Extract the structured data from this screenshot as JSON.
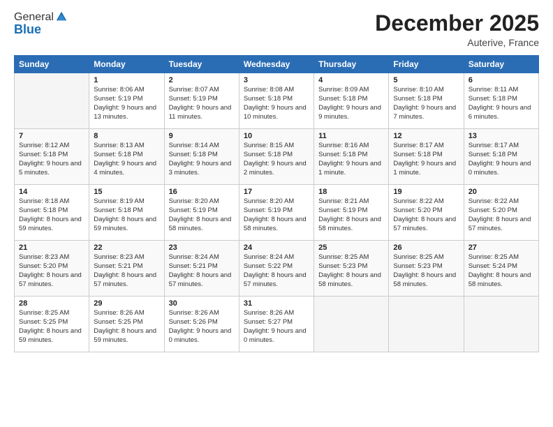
{
  "logo": {
    "general": "General",
    "blue": "Blue"
  },
  "title": "December 2025",
  "location": "Auterive, France",
  "header_days": [
    "Sunday",
    "Monday",
    "Tuesday",
    "Wednesday",
    "Thursday",
    "Friday",
    "Saturday"
  ],
  "weeks": [
    [
      {
        "day": "",
        "sunrise": "",
        "sunset": "",
        "daylight": ""
      },
      {
        "day": "1",
        "sunrise": "Sunrise: 8:06 AM",
        "sunset": "Sunset: 5:19 PM",
        "daylight": "Daylight: 9 hours and 13 minutes."
      },
      {
        "day": "2",
        "sunrise": "Sunrise: 8:07 AM",
        "sunset": "Sunset: 5:19 PM",
        "daylight": "Daylight: 9 hours and 11 minutes."
      },
      {
        "day": "3",
        "sunrise": "Sunrise: 8:08 AM",
        "sunset": "Sunset: 5:18 PM",
        "daylight": "Daylight: 9 hours and 10 minutes."
      },
      {
        "day": "4",
        "sunrise": "Sunrise: 8:09 AM",
        "sunset": "Sunset: 5:18 PM",
        "daylight": "Daylight: 9 hours and 9 minutes."
      },
      {
        "day": "5",
        "sunrise": "Sunrise: 8:10 AM",
        "sunset": "Sunset: 5:18 PM",
        "daylight": "Daylight: 9 hours and 7 minutes."
      },
      {
        "day": "6",
        "sunrise": "Sunrise: 8:11 AM",
        "sunset": "Sunset: 5:18 PM",
        "daylight": "Daylight: 9 hours and 6 minutes."
      }
    ],
    [
      {
        "day": "7",
        "sunrise": "Sunrise: 8:12 AM",
        "sunset": "Sunset: 5:18 PM",
        "daylight": "Daylight: 9 hours and 5 minutes."
      },
      {
        "day": "8",
        "sunrise": "Sunrise: 8:13 AM",
        "sunset": "Sunset: 5:18 PM",
        "daylight": "Daylight: 9 hours and 4 minutes."
      },
      {
        "day": "9",
        "sunrise": "Sunrise: 8:14 AM",
        "sunset": "Sunset: 5:18 PM",
        "daylight": "Daylight: 9 hours and 3 minutes."
      },
      {
        "day": "10",
        "sunrise": "Sunrise: 8:15 AM",
        "sunset": "Sunset: 5:18 PM",
        "daylight": "Daylight: 9 hours and 2 minutes."
      },
      {
        "day": "11",
        "sunrise": "Sunrise: 8:16 AM",
        "sunset": "Sunset: 5:18 PM",
        "daylight": "Daylight: 9 hours and 1 minute."
      },
      {
        "day": "12",
        "sunrise": "Sunrise: 8:17 AM",
        "sunset": "Sunset: 5:18 PM",
        "daylight": "Daylight: 9 hours and 1 minute."
      },
      {
        "day": "13",
        "sunrise": "Sunrise: 8:17 AM",
        "sunset": "Sunset: 5:18 PM",
        "daylight": "Daylight: 9 hours and 0 minutes."
      }
    ],
    [
      {
        "day": "14",
        "sunrise": "Sunrise: 8:18 AM",
        "sunset": "Sunset: 5:18 PM",
        "daylight": "Daylight: 8 hours and 59 minutes."
      },
      {
        "day": "15",
        "sunrise": "Sunrise: 8:19 AM",
        "sunset": "Sunset: 5:18 PM",
        "daylight": "Daylight: 8 hours and 59 minutes."
      },
      {
        "day": "16",
        "sunrise": "Sunrise: 8:20 AM",
        "sunset": "Sunset: 5:19 PM",
        "daylight": "Daylight: 8 hours and 58 minutes."
      },
      {
        "day": "17",
        "sunrise": "Sunrise: 8:20 AM",
        "sunset": "Sunset: 5:19 PM",
        "daylight": "Daylight: 8 hours and 58 minutes."
      },
      {
        "day": "18",
        "sunrise": "Sunrise: 8:21 AM",
        "sunset": "Sunset: 5:19 PM",
        "daylight": "Daylight: 8 hours and 58 minutes."
      },
      {
        "day": "19",
        "sunrise": "Sunrise: 8:22 AM",
        "sunset": "Sunset: 5:20 PM",
        "daylight": "Daylight: 8 hours and 57 minutes."
      },
      {
        "day": "20",
        "sunrise": "Sunrise: 8:22 AM",
        "sunset": "Sunset: 5:20 PM",
        "daylight": "Daylight: 8 hours and 57 minutes."
      }
    ],
    [
      {
        "day": "21",
        "sunrise": "Sunrise: 8:23 AM",
        "sunset": "Sunset: 5:20 PM",
        "daylight": "Daylight: 8 hours and 57 minutes."
      },
      {
        "day": "22",
        "sunrise": "Sunrise: 8:23 AM",
        "sunset": "Sunset: 5:21 PM",
        "daylight": "Daylight: 8 hours and 57 minutes."
      },
      {
        "day": "23",
        "sunrise": "Sunrise: 8:24 AM",
        "sunset": "Sunset: 5:21 PM",
        "daylight": "Daylight: 8 hours and 57 minutes."
      },
      {
        "day": "24",
        "sunrise": "Sunrise: 8:24 AM",
        "sunset": "Sunset: 5:22 PM",
        "daylight": "Daylight: 8 hours and 57 minutes."
      },
      {
        "day": "25",
        "sunrise": "Sunrise: 8:25 AM",
        "sunset": "Sunset: 5:23 PM",
        "daylight": "Daylight: 8 hours and 58 minutes."
      },
      {
        "day": "26",
        "sunrise": "Sunrise: 8:25 AM",
        "sunset": "Sunset: 5:23 PM",
        "daylight": "Daylight: 8 hours and 58 minutes."
      },
      {
        "day": "27",
        "sunrise": "Sunrise: 8:25 AM",
        "sunset": "Sunset: 5:24 PM",
        "daylight": "Daylight: 8 hours and 58 minutes."
      }
    ],
    [
      {
        "day": "28",
        "sunrise": "Sunrise: 8:25 AM",
        "sunset": "Sunset: 5:25 PM",
        "daylight": "Daylight: 8 hours and 59 minutes."
      },
      {
        "day": "29",
        "sunrise": "Sunrise: 8:26 AM",
        "sunset": "Sunset: 5:25 PM",
        "daylight": "Daylight: 8 hours and 59 minutes."
      },
      {
        "day": "30",
        "sunrise": "Sunrise: 8:26 AM",
        "sunset": "Sunset: 5:26 PM",
        "daylight": "Daylight: 9 hours and 0 minutes."
      },
      {
        "day": "31",
        "sunrise": "Sunrise: 8:26 AM",
        "sunset": "Sunset: 5:27 PM",
        "daylight": "Daylight: 9 hours and 0 minutes."
      },
      {
        "day": "",
        "sunrise": "",
        "sunset": "",
        "daylight": ""
      },
      {
        "day": "",
        "sunrise": "",
        "sunset": "",
        "daylight": ""
      },
      {
        "day": "",
        "sunrise": "",
        "sunset": "",
        "daylight": ""
      }
    ]
  ]
}
